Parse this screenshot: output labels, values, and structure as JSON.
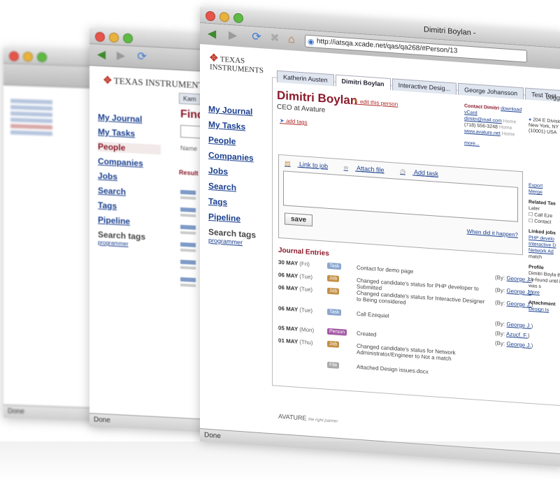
{
  "main_window": {
    "title": "Dimitri Boylan -",
    "url": "http://iatsqa.xcade.net/qas/qa268/#Person/13",
    "status": "Done",
    "logo": {
      "line1": "Texas",
      "line2": "Instruments"
    },
    "nav": [
      "My Journal",
      "My Tasks",
      "People",
      "Companies",
      "Jobs",
      "Search",
      "Tags",
      "Pipeline"
    ],
    "search_tags": {
      "title": "Search tags",
      "tag": "programmer"
    },
    "tabs": [
      "Katherin Austen",
      "Dimitri Boylan",
      "Interactive Desig...",
      "George Johansson",
      "Test Test"
    ],
    "top_right": "Logg",
    "person": {
      "name": "Dimitri Boylan",
      "role": "CEO at Avature",
      "edit_link": "edit this person",
      "add_tags": "add tags"
    },
    "contact": {
      "title": "Contact Dimitri",
      "download": "download vCard",
      "email": "dimitri@mail.com",
      "email_type": "Home",
      "phone": "(718) 556-3248",
      "phone_type": "Home",
      "web": "www.avature.net",
      "web_type": "Home",
      "more": "more...",
      "address": [
        "204 E Divisio",
        "New York, NY",
        "(10001) USA"
      ]
    },
    "note": {
      "link_job": "Link to job",
      "attach_file": "Attach file",
      "add_task": "Add task",
      "save": "save",
      "when": "When did it happen?"
    },
    "journal": {
      "title": "Journal Entries",
      "entries": [
        {
          "date": "30 MAY",
          "day": "(Fri)",
          "tag": "Task",
          "text": "Contact for demo page",
          "by": "George J."
        },
        {
          "date": "06 MAY",
          "day": "(Tue)",
          "tag": "Job",
          "text": "Changed candidate's status for PHP developer to Submitted",
          "by": "George J."
        },
        {
          "date": "06 MAY",
          "day": "(Tue)",
          "tag": "Job",
          "text": "Changed candidate's status for Interactive Designer to Being considered",
          "by": "George J."
        },
        {
          "date": "06 MAY",
          "day": "(Tue)",
          "tag": "Task",
          "text": "Call Ezequiel",
          "by": "George J."
        },
        {
          "date": "06 MAY",
          "day": "(Tue)",
          "tag": "Task",
          "text": "",
          "by": "Azucf. F."
        },
        {
          "date": "05 MAY",
          "day": "(Mon)",
          "tag": "Person",
          "text": "Created",
          "by": "George J."
        },
        {
          "date": "01 MAY",
          "day": "(Thu)",
          "tag": "Job",
          "text": "Changed candidate's status for Network Administrator/Engineer to Not a match",
          "by": ""
        },
        {
          "date": "",
          "day": "",
          "tag": "File",
          "text": "Attached Design issues.docx",
          "by": ""
        }
      ]
    },
    "right_col": {
      "export": "Export",
      "merge": "Merge",
      "related_tasks": "Related Tas",
      "later": "Later",
      "task1": "Call Eze",
      "task2": "Contact",
      "linked_jobs": "Linked jobs",
      "jobs": [
        "PHP develo",
        "Interactive D",
        "Network Ad"
      ],
      "match": "match",
      "profile": "Profile",
      "profile_text": "Dimitri Boyla the co-found until it was s",
      "more": "more",
      "attachments": "Attachment",
      "attachment": "Design Is"
    },
    "footer": {
      "brand": "AVATURE",
      "tagline": "the right partner"
    }
  },
  "second_window": {
    "status": "Done",
    "nav": [
      "My Journal",
      "My Tasks",
      "People",
      "Companies",
      "Jobs",
      "Search",
      "Tags",
      "Pipeline"
    ],
    "search_tags": {
      "title": "Search tags",
      "tag": "programmer"
    },
    "heading": "Find",
    "results_label": "Result",
    "name_label": "Name",
    "tab": "Kam"
  },
  "third_window": {
    "status": "Done"
  }
}
